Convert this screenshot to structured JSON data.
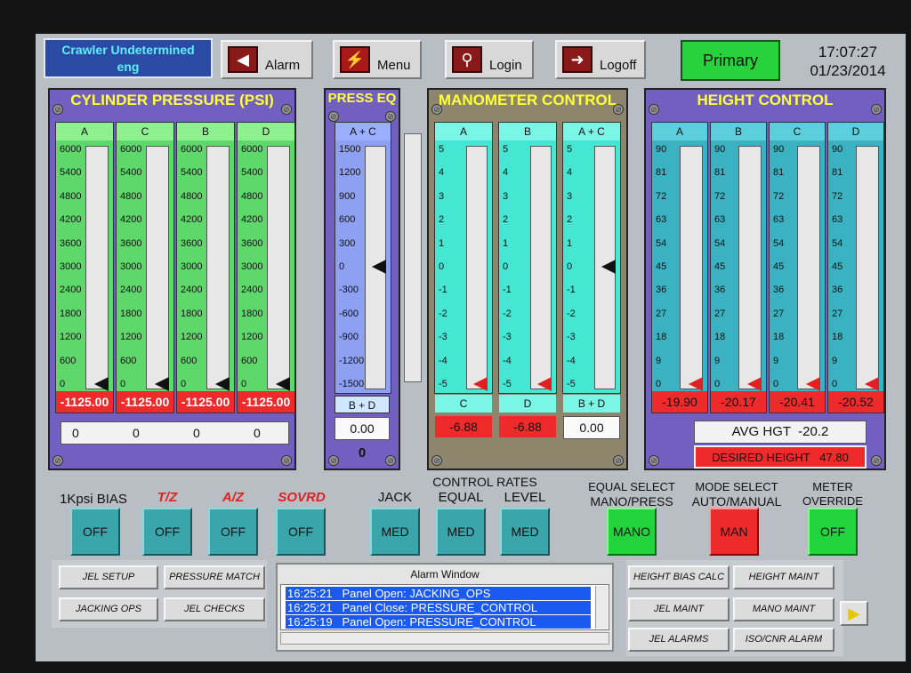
{
  "status": {
    "line1": "Crawler Undetermined",
    "line2": "eng"
  },
  "header_buttons": [
    {
      "label": "Alarm",
      "icon": "alarm-icon"
    },
    {
      "label": "Menu",
      "icon": "lightning-icon"
    },
    {
      "label": "Login",
      "icon": "key-icon"
    },
    {
      "label": "Logoff",
      "icon": "door-exit-icon"
    }
  ],
  "primary": "Primary",
  "clock": {
    "time": "17:07:27",
    "date": "01/23/2014"
  },
  "cylinder": {
    "title": "CYLINDER PRESSURE (PSI)",
    "ticks": [
      "6000",
      "5400",
      "4800",
      "4200",
      "3600",
      "3000",
      "2400",
      "1800",
      "1200",
      "600",
      "0"
    ],
    "bars": [
      {
        "label": "A",
        "reading": "-1125.00",
        "bottom": "0"
      },
      {
        "label": "C",
        "reading": "-1125.00",
        "bottom": "0"
      },
      {
        "label": "B",
        "reading": "-1125.00",
        "bottom": "0"
      },
      {
        "label": "D",
        "reading": "-1125.00",
        "bottom": "0"
      }
    ]
  },
  "press_eq": {
    "title": "PRESS EQ",
    "top_label": "A + C",
    "bottom_label": "B + D",
    "ticks": [
      "1500",
      "1200",
      "900",
      "600",
      "300",
      "0",
      "-300",
      "-600",
      "-900",
      "-1200",
      "-1500"
    ],
    "value": "0.00",
    "bottom": "0"
  },
  "manometer": {
    "title": "MANOMETER CONTROL",
    "ticks": [
      "5",
      "4",
      "3",
      "2",
      "1",
      "0",
      "-1",
      "-2",
      "-3",
      "-4",
      "-5"
    ],
    "bars": [
      {
        "label": "A",
        "bottom_label": "C",
        "reading": "-6.88",
        "alarm": true
      },
      {
        "label": "B",
        "bottom_label": "D",
        "reading": "-6.88",
        "alarm": true
      },
      {
        "label": "A + C",
        "bottom_label": "B + D",
        "reading": "0.00",
        "alarm": false
      }
    ]
  },
  "height": {
    "title": "HEIGHT CONTROL",
    "ticks": [
      "90",
      "81",
      "72",
      "63",
      "54",
      "45",
      "36",
      "27",
      "18",
      "9",
      "0"
    ],
    "bars": [
      {
        "label": "A",
        "reading": "-19.90"
      },
      {
        "label": "B",
        "reading": "-20.17"
      },
      {
        "label": "C",
        "reading": "-20.41"
      },
      {
        "label": "D",
        "reading": "-20.52"
      }
    ],
    "avg_label": "AVG HGT",
    "avg_value": "-20.2",
    "desired_label": "DESIRED HEIGHT",
    "desired_value": "47.80"
  },
  "controls": {
    "bias": {
      "label": "1Kpsi BIAS",
      "value": "OFF"
    },
    "tz": {
      "label": "T/Z",
      "value": "OFF"
    },
    "az": {
      "label": "A/Z",
      "value": "OFF"
    },
    "sovrd": {
      "label": "SOVRD",
      "value": "OFF"
    },
    "rates_title": "CONTROL RATES",
    "jack": {
      "label": "JACK",
      "value": "MED"
    },
    "equal": {
      "label": "EQUAL",
      "value": "MED"
    },
    "level": {
      "label": "LEVEL",
      "value": "MED"
    },
    "equal_select": {
      "label1": "EQUAL SELECT",
      "label2": "MANO/PRESS",
      "value": "MANO"
    },
    "mode_select": {
      "label1": "MODE SELECT",
      "label2": "AUTO/MANUAL",
      "value": "MAN"
    },
    "meter_override": {
      "label1": "METER",
      "label2": "OVERRIDE",
      "value": "OFF"
    }
  },
  "nav": {
    "jel_setup": "JEL SETUP",
    "pressure_match": "PRESSURE MATCH",
    "jacking_ops": "JACKING OPS",
    "jel_checks": "JEL CHECKS",
    "height_bias_calc": "HEIGHT BIAS CALC",
    "height_maint": "HEIGHT MAINT",
    "jel_maint": "JEL MAINT",
    "mano_maint": "MANO MAINT",
    "jel_alarms": "JEL ALARMS",
    "iso_cnr_alarm": "ISO/CNR ALARM"
  },
  "alarm_window": {
    "title": "Alarm Window",
    "entries": [
      {
        "time": "16:25:21",
        "text": "Panel Open:  JACKING_OPS"
      },
      {
        "time": "16:25:21",
        "text": "Panel Close: PRESSURE_CONTROL"
      },
      {
        "time": "16:25:19",
        "text": "Panel Open:  PRESSURE_CONTROL"
      }
    ]
  },
  "colors": {
    "green": "#5ed86a",
    "blue": "#8ea0f2",
    "cyan": "#45e6d2",
    "teal": "#3ab2c2",
    "purple": "#7260c0",
    "red": "#ee2a2a"
  }
}
